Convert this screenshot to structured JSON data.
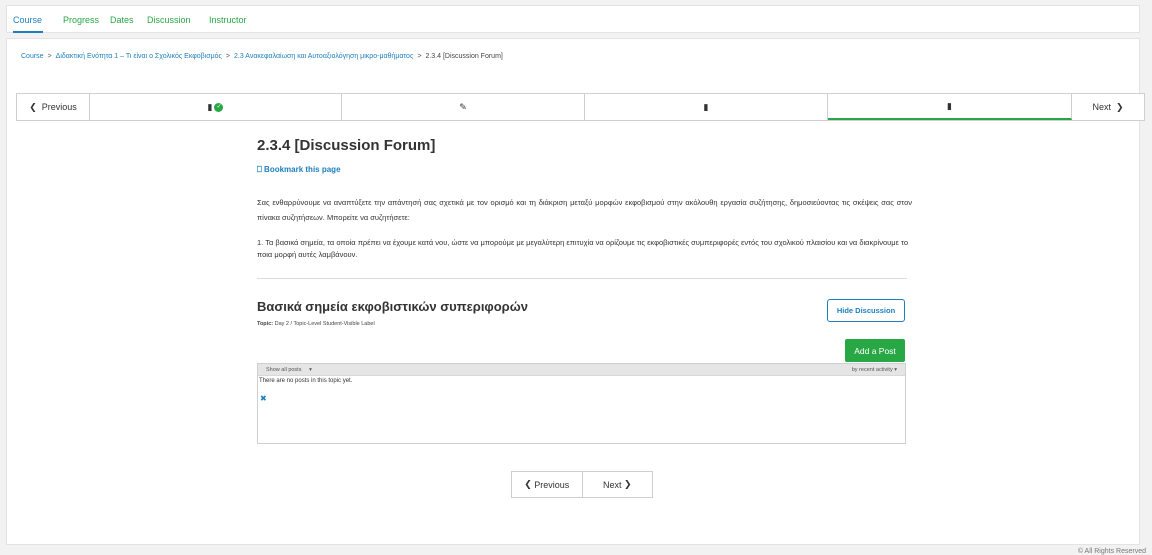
{
  "tabs": [
    "Course",
    "Progress",
    "Dates",
    "Discussion",
    "Instructor"
  ],
  "breadcrumb": {
    "items": [
      "Course",
      "Διδακτική Ενότητα 1 – Τι είναι ο Σχολικός Εκφοβισμός",
      "2.3 Ανακεφαλαίωση και Αυτοαξιολόγηση μικρο-μαθήματος"
    ],
    "current": "2.3.4 [Discussion Forum]",
    "separator": ">"
  },
  "sequence": {
    "previous_label": "Previous",
    "next_label": "Next",
    "items": [
      {
        "icon": "book-icon",
        "completed": true
      },
      {
        "icon": "edit-icon",
        "completed": false
      },
      {
        "icon": "book-icon",
        "completed": false
      },
      {
        "icon": "book-icon",
        "completed": false,
        "active": true
      }
    ]
  },
  "unit": {
    "title": "2.3.4 [Discussion Forum]",
    "bookmark_label": "Bookmark this page",
    "intro": "Σας ενθαρρύνουμε να αναπτύξετε την απάντησή σας σχετικά με τον ορισμό και τη διάκριση μεταξύ μορφών εκφοβισμού στην ακόλουθη εργασία συζήτησης, δημοσιεύοντας τις σκέψεις σας στον πίνακα συζητήσεων. Μπορείτε να συζητήσετε:",
    "list_item": "1. Τα βασικά σημεία, τα οποία πρέπει να έχουμε κατά νου, ώστε να μπορούμε με μεγαλύτερη επιτυχία να ορίζουμε τις εκφοβιστικές συμπεριφορές εντός του σχολικού πλαισίου και να διακρίνουμε το ποια μορφή αυτές λαμβάνουν."
  },
  "discussion": {
    "title": "Βασικά σημεία εκφοβιστικών συπεριφορών",
    "topic_label": "Topic:",
    "topic_value": "Day 2 / Topic-Level Student-Visible Label",
    "hide_button": "Hide Discussion",
    "add_button": "Add a Post",
    "filter": "Show all posts",
    "sort": "by recent activity",
    "empty_text": "There are no posts in this topic yet."
  },
  "pager": {
    "previous": "Previous",
    "next": "Next"
  },
  "footer": "© All Rights Reserved",
  "colors": {
    "accent": "#1d7fbf",
    "success": "#28a745"
  }
}
